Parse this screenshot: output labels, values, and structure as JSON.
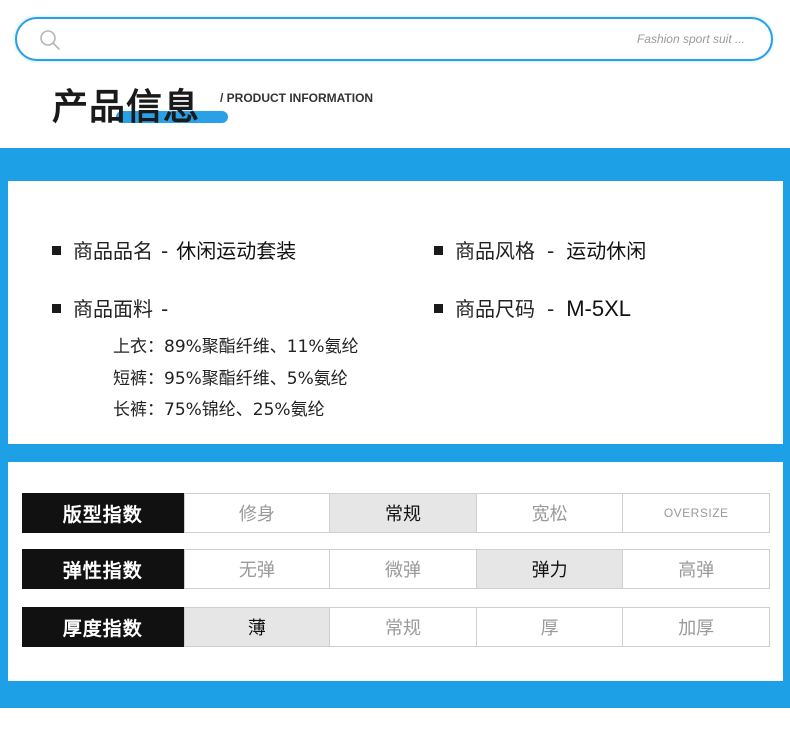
{
  "search": {
    "placeholder": "Fashion sport suit ..."
  },
  "section": {
    "title": "产品信息",
    "subtitle": "/ PRODUCT INFORMATION"
  },
  "product_info": {
    "name": {
      "label": "商品品名",
      "sep": "-",
      "value": "休闲运动套装"
    },
    "style": {
      "label": "商品风格",
      "sep": "-",
      "value": "运动休闲"
    },
    "fabric": {
      "label": "商品面料",
      "sep": "-",
      "value": ""
    },
    "size": {
      "label": "商品尺码",
      "sep": "-",
      "value": "M-5XL"
    },
    "fabric_lines": [
      "上衣：89%聚酯纤维、11%氨纶",
      "短裤：95%聚酯纤维、5%氨纶",
      "长裤：75%锦纶、25%氨纶"
    ]
  },
  "indices": [
    {
      "label": "版型指数",
      "options": [
        "修身",
        "常规",
        "宽松",
        "OVERSIZE"
      ],
      "selected": "常规"
    },
    {
      "label": "弹性指数",
      "options": [
        "无弹",
        "微弹",
        "弹力",
        "高弹"
      ],
      "selected": "弹力"
    },
    {
      "label": "厚度指数",
      "options": [
        "薄",
        "常规",
        "厚",
        "加厚"
      ],
      "selected": "薄"
    }
  ],
  "colors": {
    "accent": "#1ea0e6",
    "label_bg": "#111111",
    "selected_bg": "#e6e6e6"
  }
}
